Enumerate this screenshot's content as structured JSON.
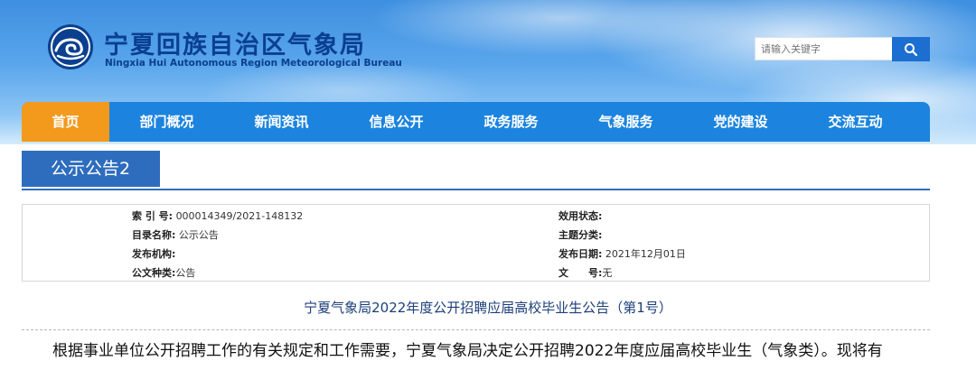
{
  "header": {
    "title": "宁夏回族自治区气象局",
    "subtitle": "Ningxia Hui Autonomous Region Meteorological Bureau",
    "search_placeholder": "请输入关键字"
  },
  "nav": {
    "items": [
      "首页",
      "部门概况",
      "新闻资讯",
      "信息公开",
      "政务服务",
      "气象服务",
      "党的建设",
      "交流互动"
    ],
    "active": "首页"
  },
  "page": {
    "heading": "公示公告2"
  },
  "info": {
    "index_label": "索 引 号:",
    "index_value": "000014349/2021-148132",
    "catalog_label": "目录名称:",
    "catalog_value": "公示公告",
    "publisher_label": "发布机构:",
    "publisher_value": "",
    "doctype_label": "公文种类:",
    "doctype_value": "公告",
    "status_label": "效用状态:",
    "status_value": "",
    "topic_label": "主题分类:",
    "topic_value": "",
    "date_label": "发布日期:",
    "date_value": "2021年12月01日",
    "docno_label": "文　　号:",
    "docno_value": "无"
  },
  "article": {
    "title": "宁夏气象局2022年度公开招聘应届高校毕业生公告（第1号）",
    "body_first_line": "根据事业单位公开招聘工作的有关规定和工作需要，宁夏气象局决定公开招聘2022年度应届高校毕业生（气象类）。现将有"
  },
  "colors": {
    "brand_blue": "#0b3f8f",
    "nav_blue": "#1c84de",
    "active_orange": "#f39a1d",
    "heading_blue": "#2e6dbd"
  }
}
